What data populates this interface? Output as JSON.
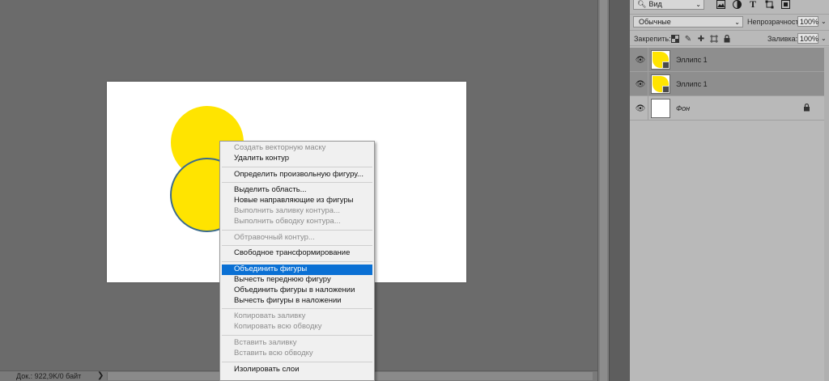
{
  "colors": {
    "shape_fill": "#ffe400",
    "shape_stroke": "#3c6c8c",
    "menu_highlight": "#0a70d4",
    "workspace": "#6b6b6b"
  },
  "status_bar": {
    "doc_info": "Док.: 922,9K/0 байт",
    "arrow": "❯"
  },
  "layers_panel": {
    "filter": {
      "kind_label": "Вид",
      "icons": [
        "image-filter-icon",
        "adjustment-filter-icon",
        "text-filter-icon",
        "shape-filter-icon",
        "smart-object-filter-icon"
      ]
    },
    "blend_mode": "Обычные",
    "opacity_label": "Непрозрачность:",
    "opacity_value": "100%",
    "lock_label": "Закрепить:",
    "fill_label": "Заливка:",
    "fill_value": "100%",
    "layers": [
      {
        "name": "Эллипс 1",
        "selected": true,
        "visible": true,
        "kind": "shape"
      },
      {
        "name": "Эллипс 1",
        "selected": true,
        "visible": true,
        "kind": "shape"
      },
      {
        "name": "Фон",
        "selected": false,
        "visible": true,
        "kind": "background",
        "locked": true
      }
    ]
  },
  "context_menu": {
    "items": [
      {
        "label": "Создать векторную маску",
        "enabled": false
      },
      {
        "label": "Удалить контур",
        "enabled": true
      },
      {
        "separator": true
      },
      {
        "label": "Определить произвольную фигуру...",
        "enabled": true
      },
      {
        "separator": true
      },
      {
        "label": "Выделить область...",
        "enabled": true
      },
      {
        "label": "Новые направляющие из фигуры",
        "enabled": true
      },
      {
        "label": "Выполнить заливку контура...",
        "enabled": false
      },
      {
        "label": "Выполнить обводку контура...",
        "enabled": false
      },
      {
        "separator": true
      },
      {
        "label": "Обтравочный контур...",
        "enabled": false
      },
      {
        "separator": true
      },
      {
        "label": "Свободное трансформирование",
        "enabled": true
      },
      {
        "separator": true
      },
      {
        "label": "Объединить фигуры",
        "enabled": true,
        "highlighted": true
      },
      {
        "label": "Вычесть переднюю фигуру",
        "enabled": true
      },
      {
        "label": "Объединить фигуры в наложении",
        "enabled": true
      },
      {
        "label": "Вычесть фигуры в наложении",
        "enabled": true
      },
      {
        "separator": true
      },
      {
        "label": "Копировать заливку",
        "enabled": false
      },
      {
        "label": "Копировать всю обводку",
        "enabled": false
      },
      {
        "separator": true
      },
      {
        "label": "Вставить заливку",
        "enabled": false
      },
      {
        "label": "Вставить всю обводку",
        "enabled": false
      },
      {
        "separator": true
      },
      {
        "label": "Изолировать слои",
        "enabled": true
      }
    ]
  }
}
